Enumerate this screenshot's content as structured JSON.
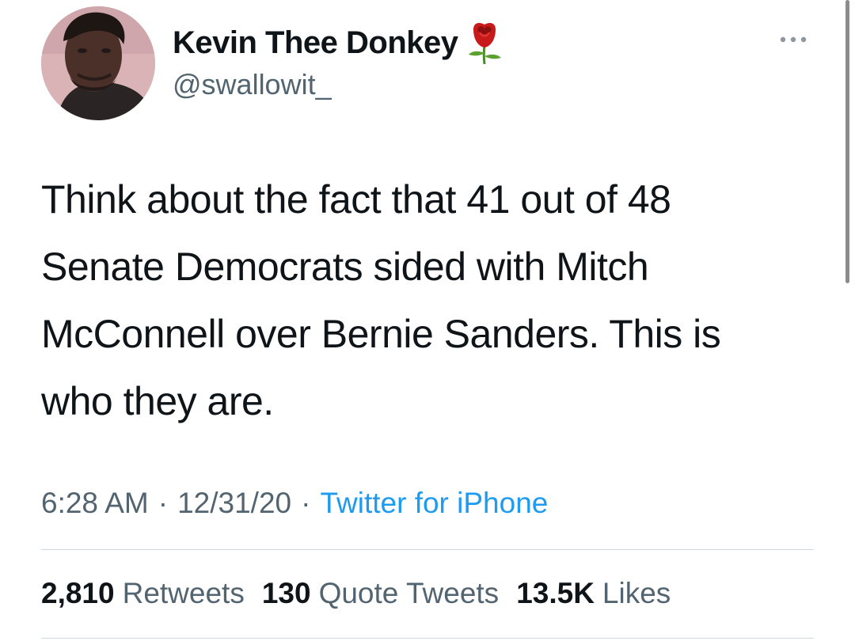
{
  "author": {
    "display_name": "Kevin Thee Donkey",
    "handle": "@swallowit_",
    "name_emoji_icon": "rose-icon"
  },
  "more_icon": "more-horizontal-icon",
  "tweet": {
    "text": "Think about the fact that 41 out of 48 Senate Democrats sided with Mitch McConnell over Bernie Sanders. This is who they are."
  },
  "meta": {
    "time": "6:28 AM",
    "separator": "·",
    "date": "12/31/20",
    "source": "Twitter for iPhone"
  },
  "stats": {
    "retweets_count": "2,810",
    "retweets_label": "Retweets",
    "quote_tweets_count": "130",
    "quote_tweets_label": "Quote Tweets",
    "likes_count": "13.5K",
    "likes_label": "Likes"
  },
  "colors": {
    "text_primary": "#0f1419",
    "text_secondary": "#536471",
    "link": "#1d9bf0",
    "divider": "#cfd9de",
    "background": "#ffffff"
  }
}
